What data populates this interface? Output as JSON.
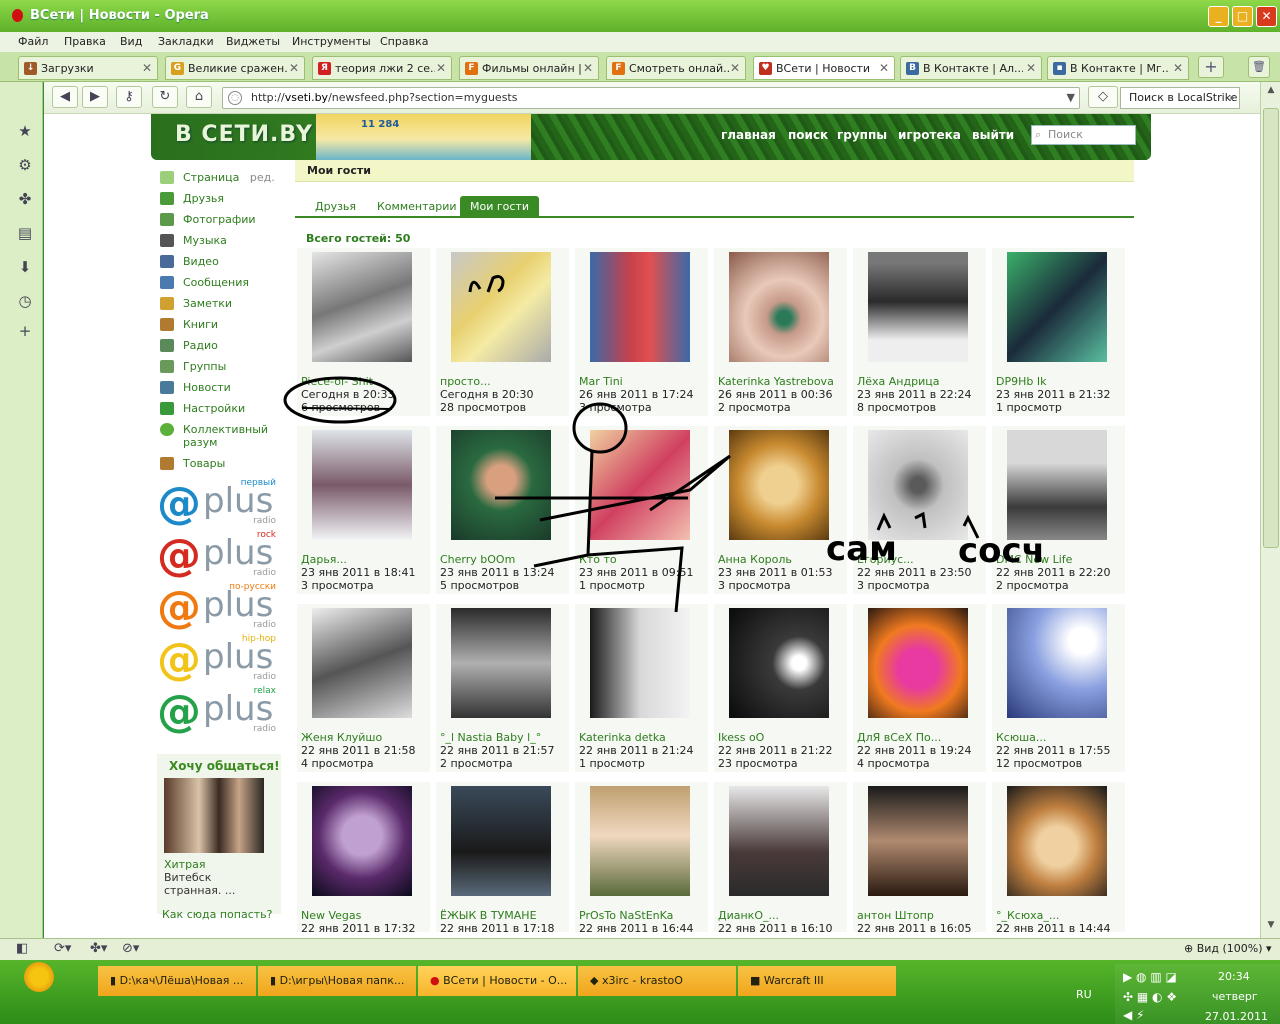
{
  "window": {
    "title": "ВСети | Новости - Opera",
    "min": "_",
    "max": "□",
    "close": "✕"
  },
  "menu": [
    "Файл",
    "Правка",
    "Вид",
    "Закладки",
    "Виджеты",
    "Инструменты",
    "Справка"
  ],
  "tabs": [
    {
      "label": "Загрузки",
      "icon": "download-icon",
      "color": "#a05a2a"
    },
    {
      "label": "Великие сражен...",
      "icon": "page-icon",
      "color": "#d8a020"
    },
    {
      "label": "теория лжи 2 се...",
      "icon": "yandex-icon",
      "color": "#d02020"
    },
    {
      "label": "Фильмы онлайн |...",
      "icon": "f-icon",
      "color": "#e07010"
    },
    {
      "label": "Смотреть онлай...",
      "icon": "f-icon",
      "color": "#e07010"
    },
    {
      "label": "ВСети | Новости",
      "icon": "vseti-icon",
      "color": "#c03020"
    },
    {
      "label": "В Контакте | Ал...",
      "icon": "vk-icon",
      "color": "#3b6aa0"
    },
    {
      "label": "В Контакте | Мг...",
      "icon": "chat-icon",
      "color": "#3b6aa0"
    }
  ],
  "address": {
    "prefix": "http://",
    "host": "vseti.by",
    "path": "/newsfeed.php?section=myguests"
  },
  "browser_search": {
    "placeholder": "Поиск в LocalStrike"
  },
  "site": {
    "brand": "В СЕТИ.BY",
    "counter": "11 284",
    "nav": [
      "главная",
      "поиск",
      "группы",
      "игротека",
      "выйти"
    ],
    "search_placeholder": "Поиск"
  },
  "sidebar": {
    "items": [
      {
        "label": "Страница",
        "extra": "ред.",
        "color": "#6aa84f"
      },
      {
        "label": "Друзья",
        "color": "#4a9a3a"
      },
      {
        "label": "Фотографии",
        "color": "#5a9a4a"
      },
      {
        "label": "Музыка",
        "color": "#555"
      },
      {
        "label": "Видео",
        "color": "#4a6a9a"
      },
      {
        "label": "Сообщения",
        "color": "#4a7ab0"
      },
      {
        "label": "Заметки",
        "color": "#d0a030"
      },
      {
        "label": "Книги",
        "color": "#b07a30"
      },
      {
        "label": "Радио",
        "color": "#5a8a5a"
      },
      {
        "label": "Группы",
        "color": "#6a9a5a"
      },
      {
        "label": "Новости",
        "color": "#4a7a9a"
      },
      {
        "label": "Настройки",
        "color": "#3a9a3a"
      },
      {
        "label": "Коллективный разум",
        "color": "#5ab03a"
      },
      {
        "label": "Товары",
        "color": "#b07a30"
      }
    ],
    "radios": [
      {
        "genre": "первый",
        "color": "#1c89c9",
        "word": "plus",
        "sub": "radio"
      },
      {
        "genre": "rock",
        "color": "#d42a1f",
        "word": "plus",
        "sub": "radio"
      },
      {
        "genre": "по-русски",
        "color": "#f07a12",
        "word": "plus",
        "sub": "radio"
      },
      {
        "genre": "hip-hop",
        "color": "#f2c41a",
        "word": "plus",
        "sub": "radio"
      },
      {
        "genre": "relax",
        "color": "#23a24a",
        "word": "plus",
        "sub": "radio"
      }
    ],
    "promo": {
      "heading": "Хочу общаться!",
      "name": "Хитрая",
      "city": "Витебск",
      "desc": "страннaя. ..."
    },
    "howto": "Как сюда попасть?"
  },
  "main": {
    "title": "Мои гости",
    "tabs": [
      "Друзья",
      "Комментарии",
      "Мои гости"
    ],
    "total": "Всего гостей: 50",
    "guests": [
      {
        "name": "Piece-of- Shit",
        "date": "Сегодня в 20:33",
        "views": "6 просмотров",
        "img": "linear-gradient(160deg,#e5e5e5,#777 45%,#cfcfcf 70%,#555)"
      },
      {
        "name": "просто...",
        "date": "Сегодня в 20:30",
        "views": "28 просмотров",
        "img": "linear-gradient(135deg,#c8c8c8,#e8d070 40%,#f4eba4 60%,#aaa)"
      },
      {
        "name": "Mar Tini",
        "date": "26 янв 2011 в 17:24",
        "views": "3 просмотра",
        "img": "linear-gradient(90deg,#3a6aa8,#c7404a 40%,#e05050 60%,#3a6aa8)"
      },
      {
        "name": "Katerinka Yastrebova",
        "date": "26 янв 2011 в 00:36",
        "views": "2 просмотра",
        "img": "radial-gradient(circle at 55% 60%,#2a7a5a 8%,#c69a8a 20%,#e9c9b9 45%,#8a5a4a)"
      },
      {
        "name": "Лёха Андрица",
        "date": "23 янв 2011 в 22:24",
        "views": "8 просмотров",
        "img": "linear-gradient(180deg,#777 10%,#2a2a2a 45%,#eee 80%)"
      },
      {
        "name": "DP9Hb Ik",
        "date": "23 янв 2011 в 21:32",
        "views": "1 просмотр",
        "img": "linear-gradient(135deg,#3ab06a,#1a2a3a 50%,#5ac0a0)"
      },
      {
        "name": "Дарья...",
        "date": "23 янв 2011 в 18:41",
        "views": "3 просмотра",
        "img": "linear-gradient(180deg,#dfe4e8,#7a5a6a 50%,#f2f4f6)"
      },
      {
        "name": "Cherry bOOm",
        "date": "23 янв 2011 в 13:24",
        "views": "5 просмотров",
        "img": "radial-gradient(circle at 50% 45%,#d9a080 18%,#2a6a40 40%,#1a3a2a)"
      },
      {
        "name": "Кто то",
        "date": "23 янв 2011 в 09:51",
        "views": "1 просмотр",
        "img": "linear-gradient(135deg,#f0d0a0,#d04060 50%,#f3c0b0)"
      },
      {
        "name": "Анна Король",
        "date": "23 янв 2011 в 01:53",
        "views": "3 просмотра",
        "img": "radial-gradient(circle at 50% 50%,#f0d090 25%,#c88a30 55%,#5a3a10)"
      },
      {
        "name": "Егориус...",
        "date": "22 янв 2011 в 23:50",
        "views": "3 просмотра",
        "img": "radial-gradient(circle at 50% 50%,#5a5a5a 10%,#c0c0c0 35%,#e8e8e8)"
      },
      {
        "name": "DMC New Life",
        "date": "22 янв 2011 в 22:20",
        "views": "2 просмотра",
        "img": "linear-gradient(180deg,#d8d8d8 30%,#3a3a3a 70%,#888)"
      },
      {
        "name": "Женя Клуйшо",
        "date": "22 янв 2011 в 21:58",
        "views": "4 просмотра",
        "img": "linear-gradient(160deg,#eee,#555 50%,#ddd)"
      },
      {
        "name": "°_l Nastia Baby l_°",
        "date": "22 янв 2011 в 21:57",
        "views": "2 просмотра",
        "img": "linear-gradient(180deg,#2a2a2a,#b0b0b0 50%,#333)"
      },
      {
        "name": "Katerinka detka",
        "date": "22 янв 2011 в 21:24",
        "views": "1 просмотр",
        "img": "linear-gradient(90deg,#1a1a1a,#d8d8d8 50%,#f3f3f3)"
      },
      {
        "name": "Ikess oO",
        "date": "22 янв 2011 в 21:22",
        "views": "23 просмотра",
        "img": "radial-gradient(circle at 70% 50%,#ffffff 8%,#3a3a3a 30%,#0a0a0a)"
      },
      {
        "name": "ДлЯ вСеХ По...",
        "date": "22 янв 2011 в 19:24",
        "views": "4 просмотра",
        "img": "radial-gradient(circle at 50% 55%,#e83aa0 25%,#f07a20 55%,#2a1a10)"
      },
      {
        "name": "Ксюша...",
        "date": "22 янв 2011 в 17:55",
        "views": "12 просмотров",
        "img": "radial-gradient(circle at 75% 30%,#ffffff 12%,#8aa0e0 45%,#2a3a7a)"
      },
      {
        "name": "New Vegas",
        "date": "22 янв 2011 в 17:32",
        "views": "",
        "img": "radial-gradient(circle at 50% 45%,#c0a0d0 25%,#5a2a6a 55%,#0a0a1a)"
      },
      {
        "name": "ЁЖЫК В ТУМАНЕ",
        "date": "22 янв 2011 в 17:18",
        "views": "",
        "img": "linear-gradient(180deg,#3a4a5a,#1a1a1a 60%,#5a6a7a)"
      },
      {
        "name": "PrOsTo NaStEnKa",
        "date": "22 янв 2011 в 16:44",
        "views": "",
        "img": "linear-gradient(180deg,#c0a070,#f0d8c0 45%,#5a6a3a)"
      },
      {
        "name": "ДианкО_...",
        "date": "22 янв 2011 в 16:10",
        "views": "",
        "img": "linear-gradient(180deg,#e8e8e8,#4a3a3a 60%,#2a2a2a)"
      },
      {
        "name": "антон Штопр",
        "date": "22 янв 2011 в 16:05",
        "views": "",
        "img": "linear-gradient(180deg,#1a1a1a,#b08a70 50%,#2a1a10)"
      },
      {
        "name": "°_Ксюха_...",
        "date": "22 янв 2011 в 14:44",
        "views": "",
        "img": "radial-gradient(circle at 50% 55%,#f0d0a0 25%,#c08040 50%,#1a1a1a)"
      }
    ]
  },
  "annotations": {
    "q": "?",
    "word1": "сам",
    "word2": "сосч"
  },
  "status": {
    "zoom": "Вид (100%)"
  },
  "taskbar": {
    "buttons": [
      {
        "label": "D:\\кач\\Лёша\\Новая ...",
        "icon": "folder-icon"
      },
      {
        "label": "D:\\игры\\Новая папк...",
        "icon": "folder-icon"
      },
      {
        "label": "ВСети | Новости - О...",
        "icon": "opera-icon"
      },
      {
        "label": "x3irc - krastoO",
        "icon": "irc-icon"
      },
      {
        "label": "Warcraft III",
        "icon": "warcraft-icon"
      }
    ],
    "lang": "RU",
    "time": "20:34",
    "day": "четверг",
    "date": "27.01.2011"
  }
}
